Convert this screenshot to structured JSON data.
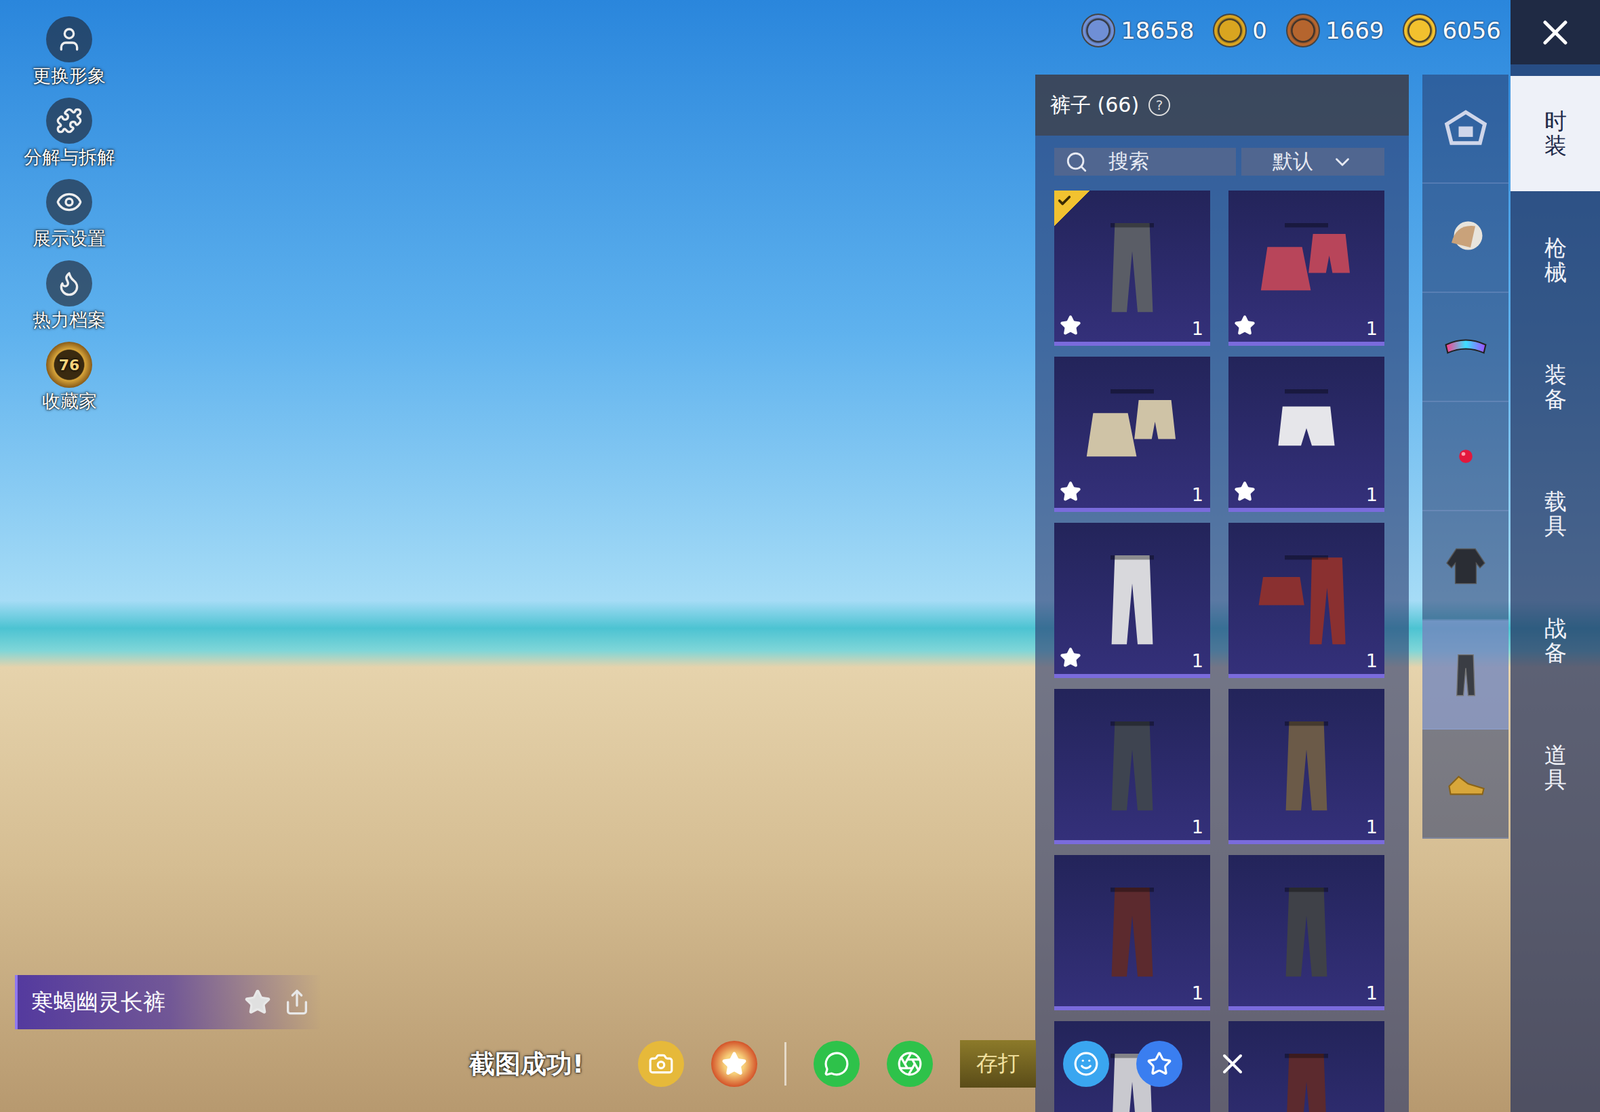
{
  "currencies": [
    {
      "amount": "18658",
      "color": "#6f8fd6"
    },
    {
      "amount": "0",
      "color": "#d9a520"
    },
    {
      "amount": "1669",
      "color": "#b5652e"
    },
    {
      "amount": "6056",
      "color": "#f2c12e"
    }
  ],
  "side_menu": [
    {
      "label": "更换形象",
      "kind": "user"
    },
    {
      "label": "分解与拆解",
      "kind": "puzzle"
    },
    {
      "label": "展示设置",
      "kind": "eye"
    },
    {
      "label": "热力档案",
      "kind": "flame"
    },
    {
      "label": "收藏家",
      "kind": "badge",
      "badge": "76"
    }
  ],
  "panel": {
    "title": "裤子 (66)",
    "help": "?",
    "search": {
      "placeholder": "搜索"
    },
    "sort": {
      "value": "默认"
    }
  },
  "items": [
    {
      "count": "1",
      "starred": true,
      "selected": true,
      "kind": "pants",
      "color": "#5a5d66"
    },
    {
      "count": "1",
      "starred": true,
      "selected": false,
      "kind": "skirt-shorts",
      "color": "#b8455a"
    },
    {
      "count": "1",
      "starred": true,
      "selected": false,
      "kind": "skirt-shorts",
      "color": "#cfc3a6"
    },
    {
      "count": "1",
      "starred": true,
      "selected": false,
      "kind": "shorts",
      "color": "#e6e6ea"
    },
    {
      "count": "1",
      "starred": true,
      "selected": false,
      "kind": "pants",
      "color": "#d8d8dc"
    },
    {
      "count": "1",
      "starred": false,
      "selected": false,
      "kind": "skirt-pants",
      "color": "#8a3030"
    },
    {
      "count": "1",
      "starred": false,
      "selected": false,
      "kind": "pants",
      "color": "#3e4450"
    },
    {
      "count": "1",
      "starred": false,
      "selected": false,
      "kind": "pants",
      "color": "#6b5a48"
    },
    {
      "count": "1",
      "starred": false,
      "selected": false,
      "kind": "pants",
      "color": "#5c2a2e"
    },
    {
      "count": "1",
      "starred": false,
      "selected": false,
      "kind": "pants",
      "color": "#3f4148"
    },
    {
      "starred": false,
      "selected": false,
      "kind": "pants",
      "color": "#c9c9cf"
    },
    {
      "starred": false,
      "selected": false,
      "kind": "pants",
      "color": "#5c2a2e"
    }
  ],
  "categories": [
    {
      "kind": "logo",
      "selected": false
    },
    {
      "kind": "hair",
      "selected": false
    },
    {
      "kind": "glasses",
      "selected": false
    },
    {
      "kind": "nose",
      "selected": false
    },
    {
      "kind": "jacket",
      "selected": false
    },
    {
      "kind": "pants",
      "selected": true
    },
    {
      "kind": "shoes",
      "selected": false
    }
  ],
  "tabs": [
    {
      "label": "时装",
      "selected": true
    },
    {
      "label": "枪械",
      "selected": false
    },
    {
      "label": "装备",
      "selected": false
    },
    {
      "label": "载具",
      "selected": false
    },
    {
      "label": "战备",
      "selected": false
    },
    {
      "label": "道具",
      "selected": false
    }
  ],
  "preview": {
    "name": "寒蝎幽灵长裤"
  },
  "toast": {
    "text": "截图成功!"
  },
  "share": [
    {
      "kind": "camera"
    },
    {
      "kind": "game"
    },
    {
      "kind": "divider"
    },
    {
      "kind": "wechat"
    },
    {
      "kind": "moments"
    },
    {
      "kind": "save",
      "label": "存打"
    },
    {
      "kind": "qq"
    },
    {
      "kind": "qzone"
    },
    {
      "kind": "close"
    }
  ]
}
